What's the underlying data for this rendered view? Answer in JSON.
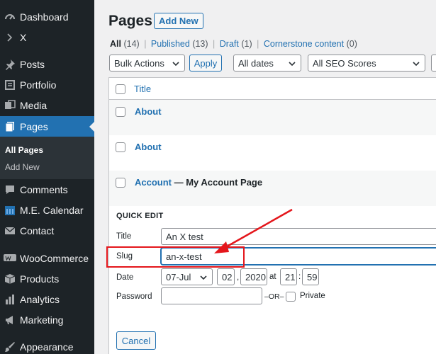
{
  "sidebar": {
    "items": [
      {
        "label": "Dashboard",
        "icon": "dashboard-icon"
      },
      {
        "label": "X",
        "icon": "chevron-right-icon"
      },
      {
        "label": "Posts",
        "icon": "pin-icon"
      },
      {
        "label": "Portfolio",
        "icon": "portfolio-icon"
      },
      {
        "label": "Media",
        "icon": "media-icon"
      },
      {
        "label": "Pages",
        "icon": "pages-icon"
      },
      {
        "label": "Comments",
        "icon": "comment-icon"
      },
      {
        "label": "M.E. Calendar",
        "icon": "calendar-icon"
      },
      {
        "label": "Contact",
        "icon": "mail-icon"
      },
      {
        "label": "WooCommerce",
        "icon": "woocommerce-icon"
      },
      {
        "label": "Products",
        "icon": "products-icon"
      },
      {
        "label": "Analytics",
        "icon": "analytics-icon"
      },
      {
        "label": "Marketing",
        "icon": "megaphone-icon"
      },
      {
        "label": "Appearance",
        "icon": "paintbrush-icon"
      }
    ],
    "submenu": [
      {
        "label": "All Pages"
      },
      {
        "label": "Add New"
      }
    ]
  },
  "header": {
    "title": "Pages",
    "add_new_label": "Add New"
  },
  "filters": {
    "all_label": "All",
    "all_count": "(14)",
    "published_label": "Published",
    "published_count": "(13)",
    "draft_label": "Draft",
    "draft_count": "(1)",
    "cornerstone_label": "Cornerstone content",
    "cornerstone_count": "(0)",
    "separator": "|"
  },
  "toolbar": {
    "bulk_actions": "Bulk Actions",
    "apply_label": "Apply",
    "dates": "All dates",
    "seo_scores": "All SEO Scores"
  },
  "table": {
    "column_title": "Title",
    "rows": [
      {
        "title": "About",
        "state": ""
      },
      {
        "title": "About",
        "state": ""
      },
      {
        "title": "Account",
        "state": " — My Account Page"
      }
    ]
  },
  "quick_edit": {
    "heading": "QUICK EDIT",
    "title_label": "Title",
    "title_value": "An X test",
    "slug_label": "Slug",
    "slug_value": "an-x-test",
    "date_label": "Date",
    "month": "07-Jul",
    "day": "02",
    "comma": ",",
    "year": "2020",
    "at_label": "at",
    "hour": "21",
    "colon": ":",
    "minute": "59",
    "password_label": "Password",
    "password_value": "",
    "or_label": "–OR–",
    "private_label": "Private",
    "cancel_label": "Cancel"
  },
  "annotation": {
    "highlight_color": "#e4161b"
  },
  "colors": {
    "sidebar_bg": "#1d2327",
    "accent": "#2271b1"
  }
}
